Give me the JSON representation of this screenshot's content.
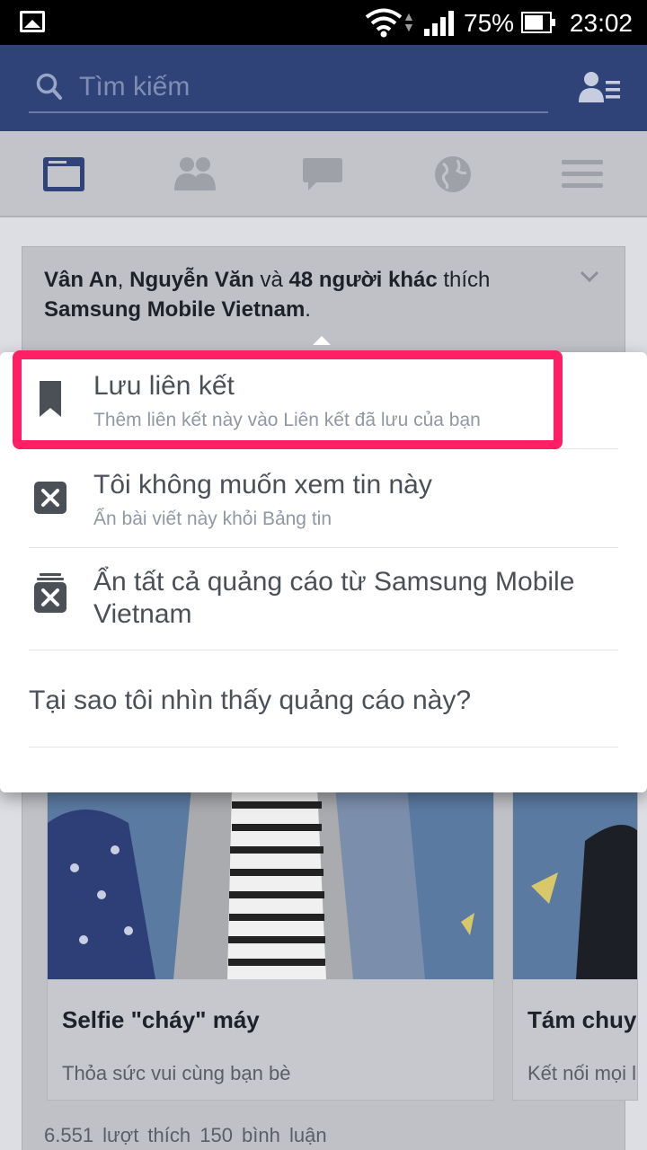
{
  "status_bar": {
    "battery_pct": "75%",
    "time": "23:02",
    "icons": [
      "gallery-icon",
      "wifi-icon",
      "signal-icon",
      "battery-icon"
    ]
  },
  "search": {
    "placeholder": "Tìm kiếm"
  },
  "nav": {
    "tabs": [
      "news-feed-icon",
      "friends-icon",
      "messages-icon",
      "globe-icon",
      "menu-icon"
    ],
    "active": "news-feed-icon"
  },
  "card": {
    "friend1": "Vân An",
    "sep1": ", ",
    "friend2": "Nguyễn Văn",
    "and": " và ",
    "others": "48 người khác",
    "liked": " thích",
    "page": "Samsung Mobile Vietnam",
    "period": ".",
    "tiles": [
      {
        "title": "Selfie \"cháy\" máy",
        "subtitle": "Thỏa sức vui cùng bạn bè"
      },
      {
        "title": "Tám chuyệ",
        "subtitle": "Kết nối mọi l"
      }
    ],
    "stats": "6.551 lượt thích  150 bình luận"
  },
  "menu": {
    "items": [
      {
        "title": "Lưu liên kết",
        "subtitle": "Thêm liên kết này vào Liên kết đã lưu của bạn",
        "icon": "bookmark-icon"
      },
      {
        "title": "Tôi không muốn xem tin này",
        "subtitle": "Ẩn bài viết này khỏi Bảng tin",
        "icon": "close-box-icon"
      },
      {
        "title": "Ẩn tất cả quảng cáo từ Samsung Mobile Vietnam",
        "icon": "hide-ads-icon"
      },
      {
        "title": "Tại sao tôi nhìn thấy quảng cáo này?"
      }
    ],
    "highlight_color": "#ff1f64"
  },
  "colors": {
    "header": "#2f4378",
    "menu_text": "#4b4f56"
  }
}
